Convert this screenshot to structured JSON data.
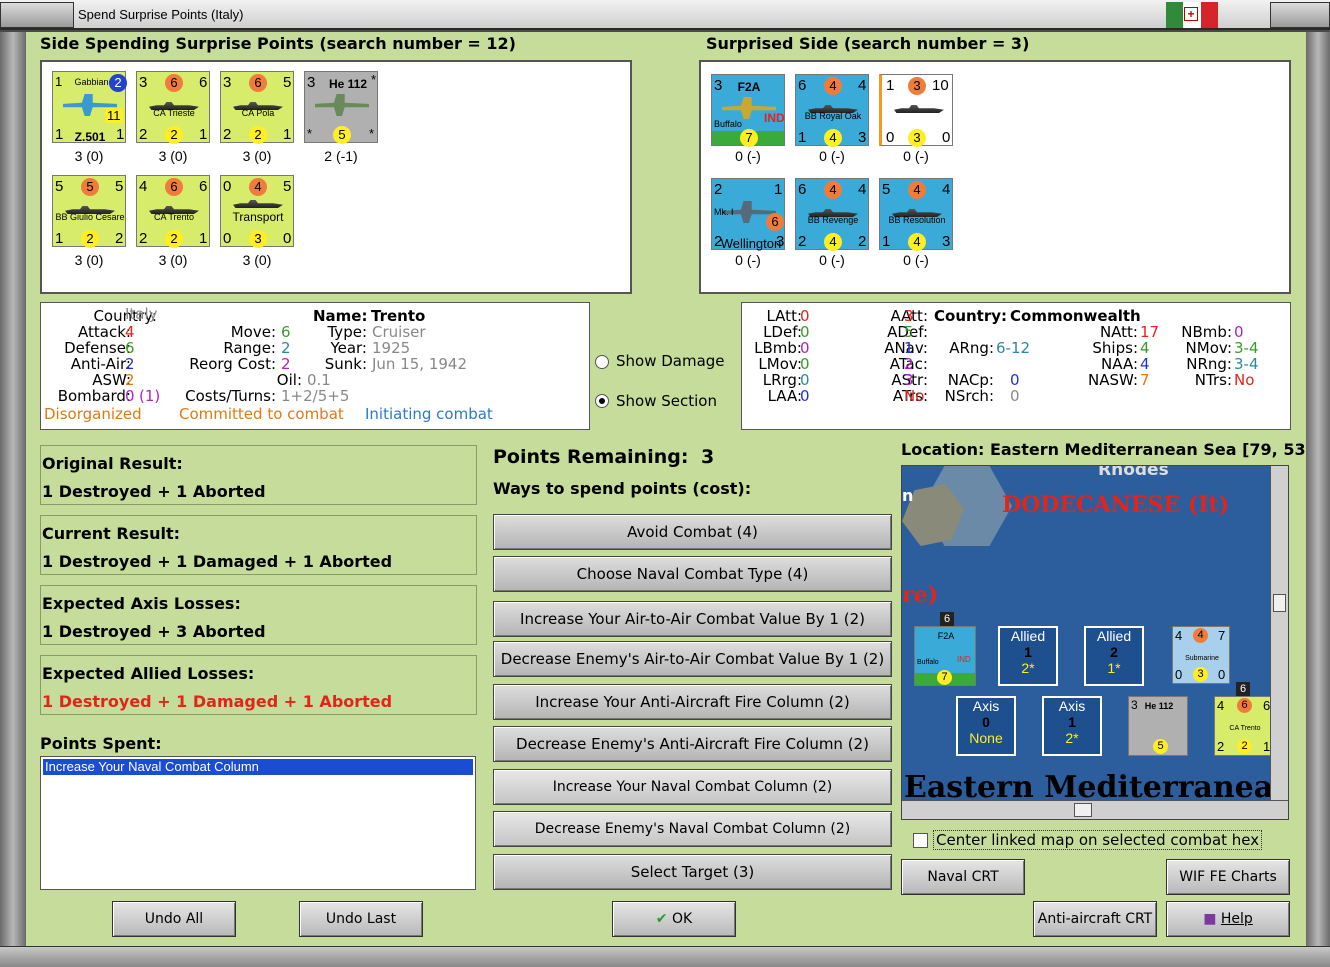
{
  "window": {
    "title": "Spend Surprise Points (Italy)"
  },
  "left_header": "Side Spending Surprise Points (search number = 12)",
  "right_header": "Surprised Side (search number = 3)",
  "left_units": [
    {
      "name": "Gabbiano",
      "sub": "Z.501",
      "tl": "1",
      "tr": "2",
      "bl": "1",
      "br": "1",
      "mid": "11",
      "count": "3 (0)",
      "color": "green",
      "kind": "plane"
    },
    {
      "name": "CA Trieste",
      "tl": "3",
      "tc": "6",
      "tr": "6",
      "bl": "2",
      "bc": "2",
      "br": "1",
      "count": "3 (0)",
      "color": "green",
      "kind": "ship"
    },
    {
      "name": "CA Pola",
      "tl": "3",
      "tc": "6",
      "tr": "5",
      "bl": "2",
      "bc": "2",
      "br": "1",
      "count": "3 (0)",
      "color": "green",
      "kind": "ship"
    },
    {
      "name": "He 112",
      "tl": "3",
      "bl": "*",
      "bc": "5",
      "br": "*",
      "tr": "*",
      "count": "2 (-1)",
      "color": "gray",
      "kind": "plane"
    },
    {
      "name": "BB Giulio Cesare",
      "tl": "5",
      "tc": "5",
      "tr": "5",
      "bl": "1",
      "bc": "2",
      "br": "2",
      "count": "3 (0)",
      "color": "green",
      "kind": "ship"
    },
    {
      "name": "CA Trento",
      "tl": "4",
      "tc": "6",
      "tr": "6",
      "bl": "2",
      "bc": "2",
      "br": "1",
      "count": "3 (0)",
      "color": "green",
      "kind": "ship"
    },
    {
      "name": "Transport",
      "tl": "0",
      "tc": "4",
      "tr": "5",
      "bl": "0",
      "bc": "3",
      "br": "0",
      "count": "3 (0)",
      "color": "green",
      "kind": "ship"
    }
  ],
  "right_units": [
    {
      "name": "F2A",
      "sub": "Buffalo",
      "tag": "IND",
      "tl": "3",
      "bc": "7",
      "count": "0 (-)",
      "color": "blue",
      "kind": "plane"
    },
    {
      "name": "BB Royal Oak",
      "tl": "6",
      "tc": "4",
      "tr": "4",
      "bl": "1",
      "bc": "4",
      "br": "3",
      "count": "0 (-)",
      "color": "blue",
      "kind": "ship"
    },
    {
      "name": "",
      "tl": "1",
      "tc": "3",
      "tr": "10",
      "bl": "0",
      "bc": "3",
      "br": "0",
      "count": "0 (-)",
      "color": "white",
      "kind": "ship"
    },
    {
      "name": "Mk. I",
      "sub": "Wellington",
      "tl": "2",
      "tr": "1",
      "mid": "6",
      "bl": "2",
      "br": "3",
      "count": "0 (-)",
      "color": "blue",
      "kind": "plane"
    },
    {
      "name": "BB Revenge",
      "tl": "6",
      "tc": "4",
      "tr": "4",
      "bl": "2",
      "bc": "4",
      "br": "2",
      "count": "0 (-)",
      "color": "blue",
      "kind": "ship"
    },
    {
      "name": "BB Resolution",
      "tl": "5",
      "tc": "4",
      "tr": "4",
      "bl": "1",
      "bc": "4",
      "br": "3",
      "count": "0 (-)",
      "color": "blue",
      "kind": "ship"
    }
  ],
  "unit_info": {
    "country_label": "Country:",
    "country": "Italy",
    "name_label": "Name:",
    "name": "Trento",
    "attack_label": "Attack:",
    "attack": "4",
    "move_label": "Move:",
    "move": "6",
    "type_label": "Type:",
    "type": "Cruiser",
    "defense_label": "Defense:",
    "defense": "6",
    "range_label": "Range:",
    "range": "2",
    "year_label": "Year:",
    "year": "1925",
    "antiair_label": "Anti-Air:",
    "antiair": "2",
    "reorg_label": "Reorg Cost:",
    "reorg": "2",
    "sunk_label": "Sunk:",
    "sunk": "Jun 15, 1942",
    "asw_label": "ASW:",
    "asw": "2",
    "oil_label": "Oil:",
    "oil": "0.1",
    "bombard_label": "Bombard:",
    "bombard": "0",
    "bombard2": "(1)",
    "costs_label": "Costs/Turns:",
    "costs": "1+2/5+5",
    "status_disorg": "Disorganized",
    "status_committed": "Committed to combat",
    "status_init": "Initiating combat"
  },
  "show_damage": "Show Damage",
  "show_section": "Show Section",
  "right_info": {
    "col1": [
      [
        "LAtt:",
        "0"
      ],
      [
        "LDef:",
        "0"
      ],
      [
        "LBmb:",
        "0"
      ],
      [
        "LMov:",
        "0"
      ],
      [
        "LRrg:",
        "0"
      ],
      [
        "LAA:",
        "0"
      ]
    ],
    "col2": [
      [
        "AAtt:",
        "3"
      ],
      [
        "ADef:",
        "5"
      ],
      [
        "ANav:",
        "1"
      ],
      [
        "ATac:",
        "2"
      ],
      [
        "AStr:",
        "3"
      ],
      [
        "ATrs:",
        "No"
      ]
    ],
    "country_label": "Country:",
    "country": "Commonwealth",
    "arng_label": "ARng:",
    "arng": "6-12",
    "nacp_label": "NACp:",
    "nacp": "0",
    "nsrch_label": "NSrch:",
    "nsrch": "0",
    "col4": [
      [
        "NAtt:",
        "17"
      ],
      [
        "Ships:",
        "4"
      ],
      [
        "NAA:",
        "4"
      ],
      [
        "NASW:",
        "7"
      ]
    ],
    "col5": [
      [
        "NBmb:",
        "0"
      ],
      [
        "NMov:",
        "3-4"
      ],
      [
        "NRng:",
        "3-4"
      ],
      [
        "NTrs:",
        "No"
      ]
    ]
  },
  "results": {
    "original_label": "Original Result:",
    "original": "1 Destroyed + 1 Aborted",
    "current_label": "Current Result:",
    "current": "1 Destroyed + 1 Damaged + 1 Aborted",
    "axis_label": "Expected Axis Losses:",
    "axis": "1 Destroyed + 3 Aborted",
    "allied_label": "Expected Allied Losses:",
    "allied": "1 Destroyed + 1 Damaged + 1 Aborted"
  },
  "points_spent_label": "Points Spent:",
  "points_spent_items": [
    "Increase Your Naval Combat Column"
  ],
  "points_remaining_label": "Points Remaining:",
  "points_remaining": "3",
  "ways_label": "Ways to spend points (cost):",
  "spend_options": [
    "Avoid Combat (4)",
    "Choose Naval Combat Type (4)",
    "Increase Your Air-to-Air Combat Value By 1 (2)",
    "Decrease Enemy's Air-to-Air Combat Value By 1 (2)",
    "Increase Your Anti-Aircraft Fire Column (2)",
    "Decrease Enemy's Anti-Aircraft Fire Column (2)",
    "Increase Your Naval Combat Column (2)",
    "Decrease Enemy's Naval Combat Column (2)",
    "Select Target (3)"
  ],
  "location_label": "Location: Eastern Mediterranean Sea [79, 53",
  "map": {
    "rhodes": "Rhodes",
    "dodecanese": "DODECANESE (It)",
    "re_frag": "re)",
    "n_frag": "n",
    "sea_name": "Eastern Mediterranea",
    "allied1_title": "Allied",
    "allied1_num": "1",
    "allied1_sub": "2*",
    "allied2_title": "Allied",
    "allied2_num": "2",
    "allied2_sub": "1*",
    "axis1_title": "Axis",
    "axis1_num": "0",
    "axis1_sub": "None",
    "axis2_title": "Axis",
    "axis2_num": "1",
    "axis2_sub": "2*",
    "sub_name": "Submarine",
    "he112": "He 112",
    "trento": "CA Trento",
    "f2a": "F2A",
    "buffalo": "Buffalo",
    "ind": "IND",
    "stack6a": "6",
    "stack6b": "6",
    "v7": "7",
    "v5": "5",
    "sub_tl": "4",
    "sub_tc": "4",
    "sub_tr": "7",
    "sub_bl": "0",
    "sub_bc": "3",
    "sub_br": "0",
    "tr_tl": "4",
    "tr_tc": "6",
    "tr_tr": "6",
    "tr_bl": "2",
    "tr_bc": "2",
    "tr_br": "1",
    "he_tl": "3"
  },
  "center_linked": "Center linked map on selected combat hex",
  "buttons": {
    "undo_all": "Undo All",
    "undo_last": "Undo Last",
    "ok": "OK",
    "naval_crt": "Naval CRT",
    "wif_fe": "WIF FE Charts",
    "aa_crt": "Anti-aircraft CRT",
    "help": "Help"
  },
  "colors": {
    "panel": "#c6dc9a",
    "red": "#e0251b",
    "green": "#3a9a2a",
    "blue": "#2233cc",
    "orange": "#e07a10",
    "teal": "#2a8a9a",
    "purple": "#b022c0"
  }
}
